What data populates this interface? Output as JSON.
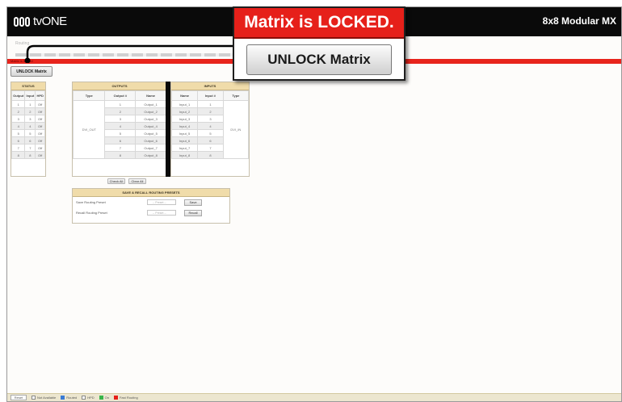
{
  "header": {
    "logo_text": "tvONE",
    "product_title": "8x8 Modular MX"
  },
  "nav": {
    "sub_item": "Routing"
  },
  "lock_bar": {
    "label": "Matrix is locked",
    "unlock_button_label": "UNLOCK Matrix"
  },
  "callout": {
    "title": "Matrix is LOCKED.",
    "button_label": "UNLOCK Matrix"
  },
  "status": {
    "heading": "STATUS",
    "columns": [
      "Output",
      "Input",
      "HPD"
    ],
    "rows": [
      [
        "1",
        "1",
        "Off"
      ],
      [
        "2",
        "2",
        "Off"
      ],
      [
        "3",
        "3",
        "Off"
      ],
      [
        "4",
        "4",
        "Off"
      ],
      [
        "5",
        "5",
        "Off"
      ],
      [
        "6",
        "6",
        "Off"
      ],
      [
        "7",
        "7",
        "Off"
      ],
      [
        "8",
        "8",
        "Off"
      ]
    ]
  },
  "outputs": {
    "heading": "OUTPUTS",
    "columns": [
      "Type",
      "Output #",
      "Name"
    ],
    "type_label": "DVI_OUT",
    "rows": [
      [
        "1",
        "Output_1"
      ],
      [
        "2",
        "Output_2"
      ],
      [
        "3",
        "Output_3"
      ],
      [
        "4",
        "Output_4"
      ],
      [
        "5",
        "Output_5"
      ],
      [
        "6",
        "Output_6"
      ],
      [
        "7",
        "Output_7"
      ],
      [
        "8",
        "Output_8"
      ]
    ],
    "check_all_label": "Check All",
    "clear_all_label": "Clear All"
  },
  "inputs": {
    "heading": "INPUTS",
    "columns": [
      "Name",
      "Input #",
      "Type"
    ],
    "type_label": "DVI_IN",
    "rows": [
      [
        "Input_1",
        "1"
      ],
      [
        "Input_2",
        "2"
      ],
      [
        "Input_3",
        "3"
      ],
      [
        "Input_4",
        "4"
      ],
      [
        "Input_5",
        "5"
      ],
      [
        "Input_6",
        "6"
      ],
      [
        "Input_7",
        "7"
      ],
      [
        "Input_8",
        "8"
      ]
    ]
  },
  "presets": {
    "heading": "SAVE & RECALL ROUTING PRESETS",
    "save_label": "Save Routing Preset",
    "save_select": "-- Preset --",
    "save_button": "Save",
    "recall_label": "Recall Routing Preset",
    "recall_select": "-- Preset --",
    "recall_button": "Recall"
  },
  "footer": {
    "reset_label": "Reset",
    "legend": [
      {
        "label": "Not Available",
        "color": "#ffffff"
      },
      {
        "label": "Routed",
        "color": "#3a7bd5"
      },
      {
        "label": "HPD",
        "color": "#ffffff"
      },
      {
        "label": "On",
        "color": "#39b54a"
      },
      {
        "label": "Fast Routing",
        "color": "#e6201a"
      }
    ]
  },
  "colors": {
    "accent_red": "#e6201a",
    "header_bg": "#0a0a0a",
    "panel_header": "#f0dcaa"
  }
}
